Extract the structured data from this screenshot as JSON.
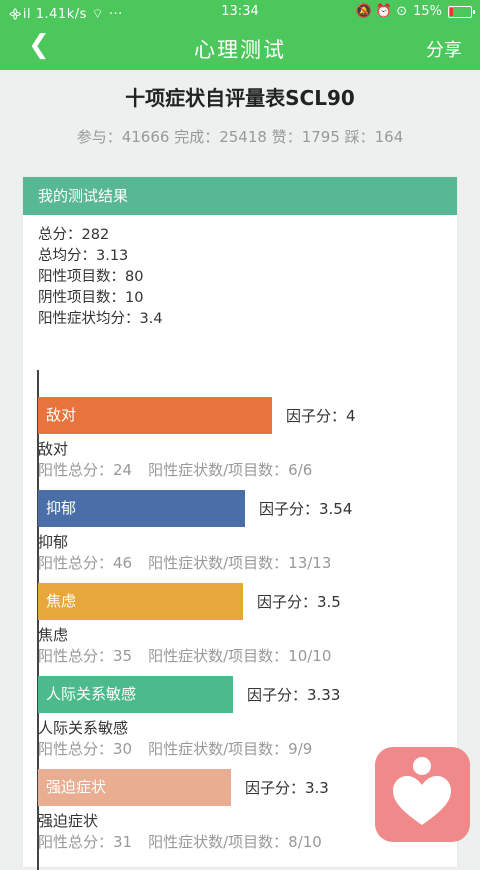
{
  "status_bar": {
    "left": "᯽il 1.41k/s ⌔ ···",
    "time": "13:34",
    "right_icons": "🔕 ⏰ ⊙",
    "battery_text": "15%",
    "battery_level": 0.15,
    "battery_color": "#e53935"
  },
  "app_bar": {
    "back_icon": "chevron-left-icon",
    "back_glyph": "❮",
    "title": "心理测试",
    "share_label": "分享"
  },
  "page": {
    "title": "十项症状自评量表SCL90",
    "stats": "参与：41666 完成：25418 赞：1795 踩：164"
  },
  "result_card": {
    "header": "我的测试结果",
    "summary": [
      "总分：282",
      "总均分：3.13",
      "阳性项目数：80",
      "阴性项目数：10",
      "阳性症状均分：3.4"
    ]
  },
  "chart_data": {
    "type": "bar",
    "orientation": "horizontal",
    "xlim": [
      0,
      4.7
    ],
    "factor_prefix": "因子分：",
    "positive_total_prefix": "阳性总分：",
    "ratio_prefix": "阳性症状数/项目数：",
    "categories": [
      "敌对",
      "抑郁",
      "焦虑",
      "人际关系敏感",
      "强迫症状"
    ],
    "values": [
      4,
      3.54,
      3.5,
      3.33,
      3.3
    ],
    "positive_totals": [
      24,
      46,
      35,
      30,
      31
    ],
    "ratios": [
      "6/6",
      "13/13",
      "10/10",
      "9/9",
      "8/10"
    ],
    "colors": [
      "#e8733d",
      "#4a6ea8",
      "#e8a73a",
      "#4dba8c",
      "#e9ae92"
    ]
  },
  "floating_badge": {
    "icon": "heart-person-logo-icon",
    "color": "#f08a8a"
  }
}
